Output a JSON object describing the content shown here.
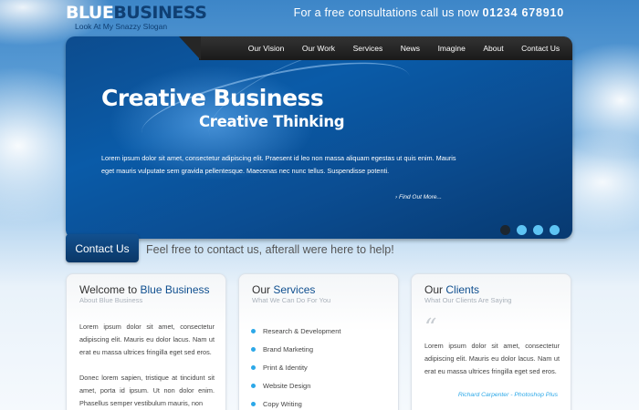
{
  "header": {
    "logo_blue": "BLUE",
    "logo_business": "BUSINESS",
    "slogan": "Look At My Snazzy Slogan",
    "phone_text": "For a free consultations call us now",
    "phone_number": "01234 678910"
  },
  "nav": {
    "items": [
      {
        "label": "Our Vision"
      },
      {
        "label": "Our Work"
      },
      {
        "label": "Services"
      },
      {
        "label": "News"
      },
      {
        "label": "Imagine"
      },
      {
        "label": "About"
      },
      {
        "label": "Contact Us"
      }
    ]
  },
  "banner": {
    "heading": "Creative Business",
    "subheading": "Creative Thinking",
    "text": "Lorem ipsum dolor sit amet, consectetur adipiscing elit. Praesent id leo non massa aliquam egestas ut quis enim. Mauris eget mauris vulputate sem gravida pellentesque. Maecenas nec nunc tellus. Suspendisse potenti.",
    "find_out": "Find Out More...",
    "slides": 4,
    "active_slide": 1
  },
  "contact": {
    "button": "Contact Us",
    "text": "Feel free to contact us, afterall were here to help!"
  },
  "boxes": {
    "welcome": {
      "title_plain": "Welcome to",
      "title_hl": "Blue Business",
      "sub": "About Blue Business",
      "para1": "Lorem ipsum dolor sit amet, consectetur adipiscing elit. Mauris eu dolor lacus. Nam ut erat eu massa ultrices fringilla eget sed eros.",
      "para2": "Donec lorem sapien, tristique at tincidunt sit amet, porta id ipsum. Ut non dolor enim. Phasellus semper vestibulum mauris, non"
    },
    "services": {
      "title_plain": "Our",
      "title_hl": "Services",
      "sub": "What We Can Do For You",
      "items": [
        "Research & Development",
        "Brand Marketing",
        "Print & Identity",
        "Website Design",
        "Copy Writing"
      ]
    },
    "clients": {
      "title_plain": "Our",
      "title_hl": "Clients",
      "sub": "What Our Clients Are Saying",
      "quote": "Lorem ipsum dolor sit amet, consectetur adipiscing elit. Mauris eu dolor lacus. Nam ut erat eu massa ultrices fringilla eget sed eros.",
      "author": "Richard Carpenter - Photoshop Plus"
    }
  },
  "colors": {
    "accent": "#0f4f8f",
    "bullet": "#2ca8e8"
  }
}
